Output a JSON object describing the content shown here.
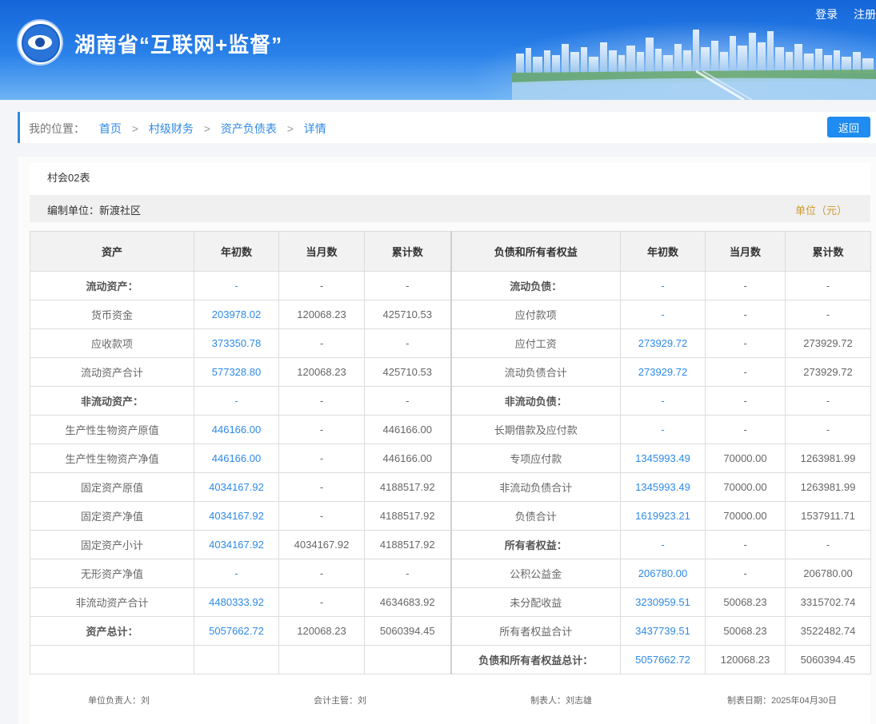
{
  "header": {
    "site_title": "湖南省“互联网+监督”",
    "login": "登录",
    "register": "注册"
  },
  "breadcrumb": {
    "prefix": "我的位置：",
    "items": [
      "首页",
      "村级财务",
      "资产负债表",
      "详情"
    ],
    "separator": ">",
    "back_label": "返回"
  },
  "report": {
    "table_no": "村会02表",
    "org": "编制单位：新渡社区",
    "unit": "单位（元）",
    "columns": [
      "资产",
      "年初数",
      "当月数",
      "累计数",
      "负债和所有者权益",
      "年初数",
      "当月数",
      "累计数"
    ],
    "rows": [
      [
        "流动资产：",
        "-",
        "-",
        "-",
        "流动负债：",
        "-",
        "-",
        "-"
      ],
      [
        "货币资金",
        "203978.02",
        "120068.23",
        "425710.53",
        "应付款项",
        "-",
        "-",
        "-"
      ],
      [
        "应收款项",
        "373350.78",
        "-",
        "-",
        "应付工资",
        "273929.72",
        "-",
        "273929.72"
      ],
      [
        "流动资产合计",
        "577328.80",
        "120068.23",
        "425710.53",
        "流动负债合计",
        "273929.72",
        "-",
        "273929.72"
      ],
      [
        "非流动资产：",
        "-",
        "-",
        "-",
        "非流动负债：",
        "-",
        "-",
        "-"
      ],
      [
        "生产性生物资产原值",
        "446166.00",
        "-",
        "446166.00",
        "长期借款及应付款",
        "-",
        "-",
        "-"
      ],
      [
        "生产性生物资产净值",
        "446166.00",
        "-",
        "446166.00",
        "专项应付款",
        "1345993.49",
        "70000.00",
        "1263981.99"
      ],
      [
        "固定资产原值",
        "4034167.92",
        "-",
        "4188517.92",
        "非流动负债合计",
        "1345993.49",
        "70000.00",
        "1263981.99"
      ],
      [
        "固定资产净值",
        "4034167.92",
        "-",
        "4188517.92",
        "负债合计",
        "1619923.21",
        "70000.00",
        "1537911.71"
      ],
      [
        "固定资产小计",
        "4034167.92",
        "4034167.92",
        "4188517.92",
        "所有者权益：",
        "-",
        "-",
        "-"
      ],
      [
        "无形资产净值",
        "-",
        "-",
        "-",
        "公积公益金",
        "206780.00",
        "-",
        "206780.00"
      ],
      [
        "非流动资产合计",
        "4480333.92",
        "-",
        "4634683.92",
        "未分配收益",
        "3230959.51",
        "50068.23",
        "3315702.74"
      ],
      [
        "资产总计：",
        "5057662.72",
        "120068.23",
        "5060394.45",
        "所有者权益合计",
        "3437739.51",
        "50068.23",
        "3522482.74"
      ],
      [
        "",
        "",
        "",
        "",
        "负债和所有者权益总计：",
        "5057662.72",
        "120068.23",
        "5060394.45"
      ]
    ],
    "bold_left": [
      0,
      4,
      12
    ],
    "bold_right": [
      0,
      4,
      9,
      13
    ],
    "footer": {
      "head": "单位负责人：刘",
      "accountant": "会计主管：刘",
      "preparer": "制表人：刘志雄",
      "date": "制表日期：2025年04月30日"
    }
  },
  "colors": {
    "accent": "#2e8ae6",
    "header_blue": "#1565d8",
    "unit_gold": "#d19a2a"
  }
}
